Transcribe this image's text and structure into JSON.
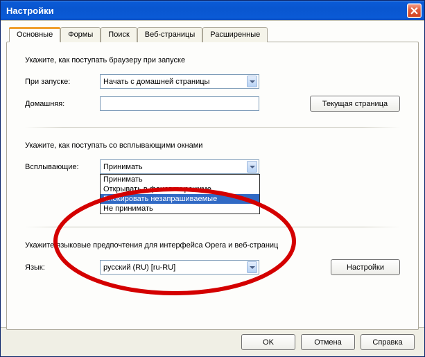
{
  "window": {
    "title": "Настройки"
  },
  "tabs": [
    "Основные",
    "Формы",
    "Поиск",
    "Веб-страницы",
    "Расширенные"
  ],
  "section_startup": {
    "heading": "Укажите, как поступать браузеру при запуске",
    "row_startup_label": "При запуске:",
    "startup_value": "Начать с домашней страницы",
    "row_home_label": "Домашняя:",
    "home_value": "",
    "btn_current_page": "Текущая страница"
  },
  "section_popups": {
    "heading": "Укажите, как поступать со всплывающими окнами",
    "row_label": "Всплывающие:",
    "value": "Принимать",
    "options": [
      "Принимать",
      "Открывать в фоновом режиме",
      "Блокировать незапрашиваемые",
      "Не принимать"
    ],
    "selected_index": 2
  },
  "section_lang": {
    "heading": "Укажите языковые предпочтения для интерфейса Opera и веб-страниц",
    "row_label": "Язык:",
    "value": "русский (RU) [ru-RU]",
    "btn_settings": "Настройки"
  },
  "footer": {
    "ok": "OK",
    "cancel": "Отмена",
    "help": "Справка"
  }
}
